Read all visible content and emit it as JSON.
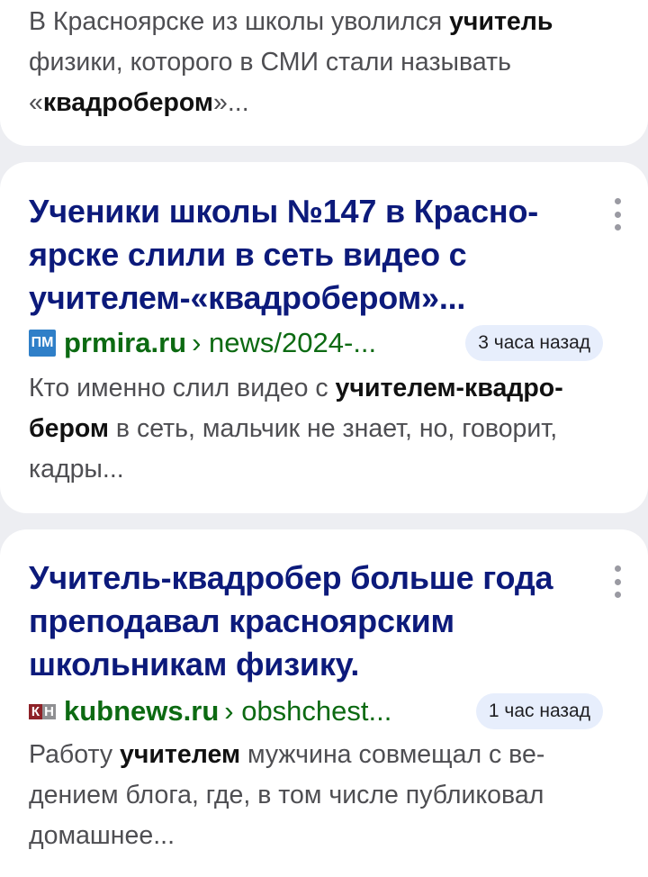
{
  "results": [
    {
      "snippet_parts": [
        {
          "text": "В Красноярске из школы уволился ",
          "bold": false
        },
        {
          "text": "учитель",
          "bold": true
        },
        {
          "text": " физики, которого в СМИ стали называть «",
          "bold": false
        },
        {
          "text": "квадробером",
          "bold": true
        },
        {
          "text": "»...",
          "bold": false
        }
      ]
    },
    {
      "title_parts": [
        {
          "text": "Ученики школы №147 в Красно­ярске слили в сеть видео с учителем-«квадробером»...",
          "bold": false
        }
      ],
      "favicon": "ПМ",
      "domain": "prmira.ru",
      "path": "› news/2024-...",
      "time": "3 часа назад",
      "snippet_parts": [
        {
          "text": "Кто именно слил видео с ",
          "bold": false
        },
        {
          "text": "учителем-квадро­бером",
          "bold": true
        },
        {
          "text": " в сеть, мальчик не знает, но, говорит, кадры...",
          "bold": false
        }
      ]
    },
    {
      "title_parts": [
        {
          "text": "Учитель-квадробер",
          "bold": true
        },
        {
          "text": " больше года преподавал красноярским школьникам физику.",
          "bold": false
        }
      ],
      "favicon_left": "К",
      "favicon_right": "Н",
      "domain": "kubnews.ru",
      "path": "› obshchest...",
      "time": "1 час назад",
      "snippet_parts": [
        {
          "text": "Работу ",
          "bold": false
        },
        {
          "text": "учителем",
          "bold": true
        },
        {
          "text": " мужчина совмещал с ве­дением блога, где, в том числе публиковал домашнее...",
          "bold": false
        }
      ]
    }
  ],
  "colors": {
    "title": "#0c1a7b",
    "url": "#0c6a12",
    "badge_bg": "#e7eefc",
    "page_bg": "#edeef2"
  },
  "icons": {
    "more": "vertical-ellipsis-icon"
  }
}
